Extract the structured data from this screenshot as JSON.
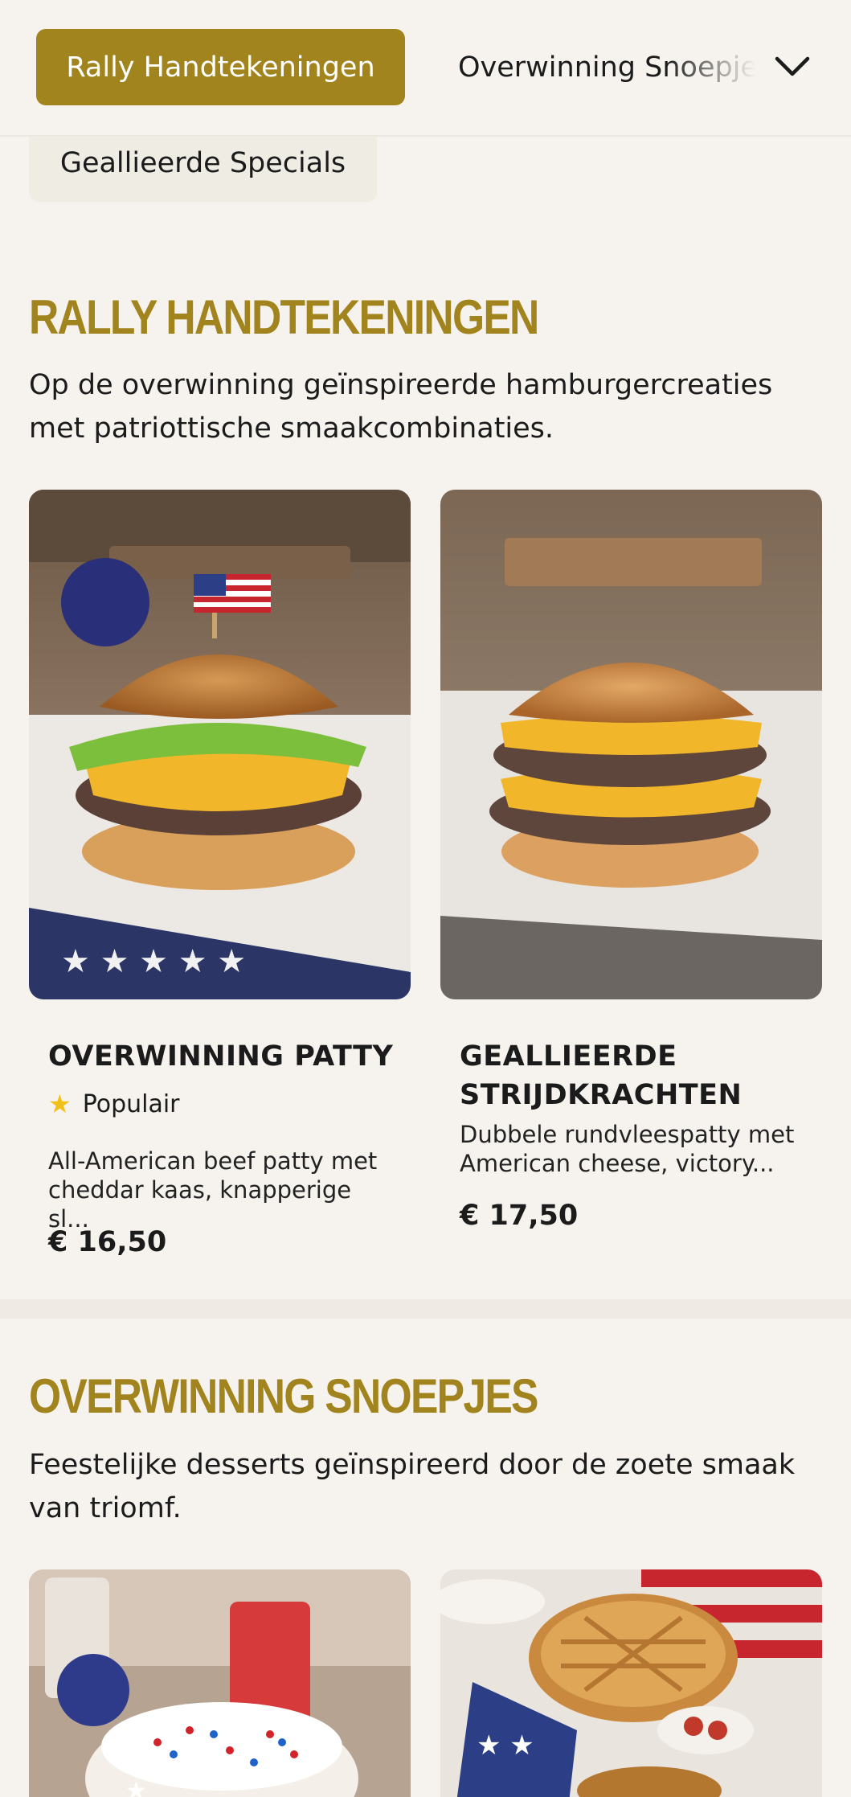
{
  "nav": {
    "active_label": "Rally Handtekeningen",
    "next_label": "Overwinning Snoepjes",
    "third_label": "Geallieerde Specials"
  },
  "sections": [
    {
      "title": "RALLY HANDTEKENINGEN",
      "description": "Op de overwinning geïnspireerde hamburgercreaties met patriottische smaakcombinaties.",
      "items": [
        {
          "name": "OVERWINNING PATTY",
          "badge": "Populair",
          "description": "All-American beef patty met cheddar kaas, knapperige sl...",
          "price": "€ 16,50",
          "image_icon": "burger-flag-photo"
        },
        {
          "name": "GEALLIEERDE STRIJDKRACHTEN",
          "description": "Dubbele rundvleespatty met American cheese, victory...",
          "price": "€ 17,50",
          "image_icon": "double-burger-photo"
        }
      ]
    },
    {
      "title": "OVERWINNING SNOEPJES",
      "description": "Feestelijke desserts geïnspireerd door de zoete smaak van triomf.",
      "items": [
        {
          "image_icon": "sprinkle-cake-photo"
        },
        {
          "image_icon": "pie-photo"
        }
      ]
    }
  ],
  "colors": {
    "accent": "#a1841e",
    "background": "#f6f3ee",
    "star": "#f2c01b"
  }
}
